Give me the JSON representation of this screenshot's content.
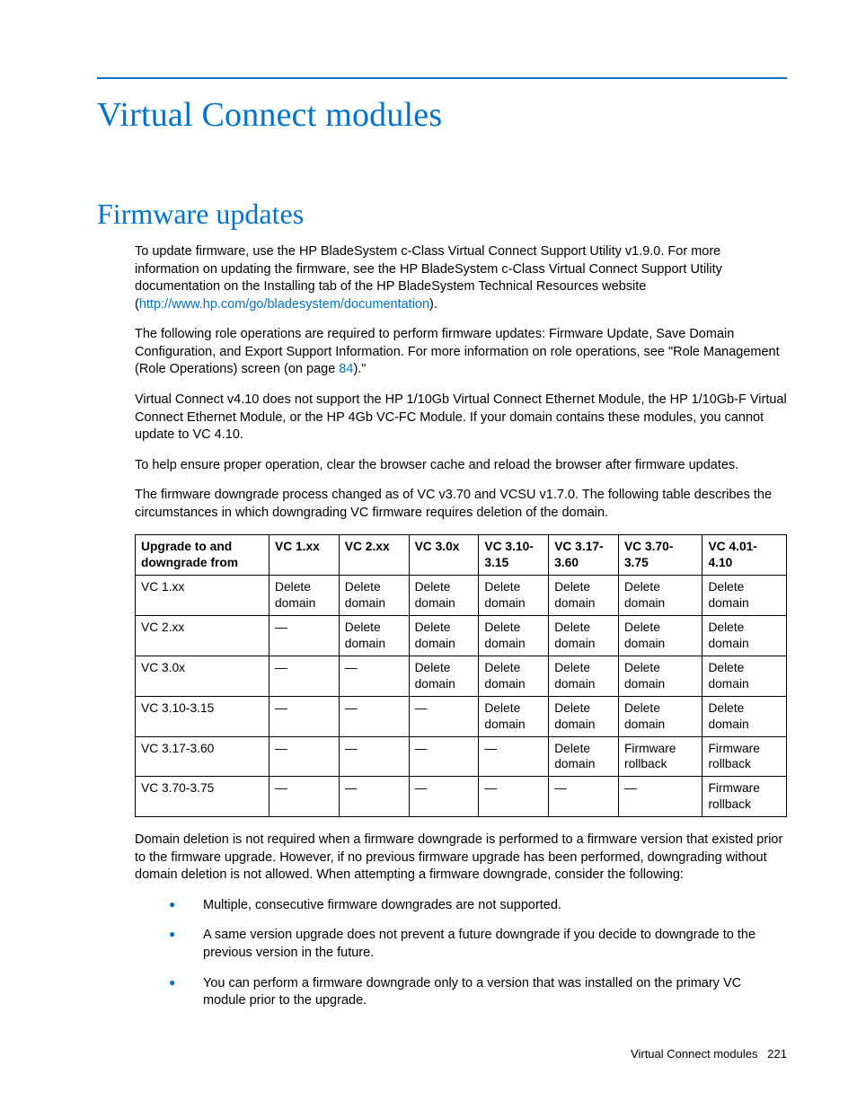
{
  "page_title": "Virtual Connect modules",
  "section_title": "Firmware updates",
  "paragraphs": {
    "p1a": "To update firmware, use the HP BladeSystem c-Class Virtual Connect Support Utility v1.9.0. For more information on updating the firmware, see the HP BladeSystem c-Class Virtual Connect Support Utility documentation on the Installing tab of the HP BladeSystem Technical Resources website (",
    "p1link": "http://www.hp.com/go/bladesystem/documentation",
    "p1b": ").",
    "p2a": "The following role operations are required to perform firmware updates: Firmware Update, Save Domain Configuration, and Export Support Information. For more information on role operations, see \"Role Management (Role Operations) screen (on page ",
    "p2page": "84",
    "p2b": ").\"",
    "p3": "Virtual Connect v4.10 does not support the HP 1/10Gb Virtual Connect Ethernet Module, the HP 1/10Gb-F Virtual Connect Ethernet Module, or the HP 4Gb VC-FC Module. If your domain contains these modules, you cannot update to VC 4.10.",
    "p4": "To help ensure proper operation, clear the browser cache and reload the browser after firmware updates.",
    "p5": "The firmware downgrade process changed as of VC v3.70 and VCSU v1.7.0. The following table describes the circumstances in which downgrading VC firmware requires deletion of the domain.",
    "p6": "Domain deletion is not required when a firmware downgrade is performed to a firmware version that existed prior to the firmware upgrade. However, if no previous firmware upgrade has been performed, downgrading without domain deletion is not allowed. When attempting a firmware downgrade, consider the following:"
  },
  "table": {
    "headers": [
      "Upgrade to and downgrade from",
      "VC 1.xx",
      "VC 2.xx",
      "VC 3.0x",
      "VC 3.10-3.15",
      "VC 3.17-3.60",
      "VC 3.70-3.75",
      "VC 4.01-4.10"
    ],
    "rows": [
      [
        "VC 1.xx",
        "Delete domain",
        "Delete domain",
        "Delete domain",
        "Delete domain",
        "Delete domain",
        "Delete domain",
        "Delete domain"
      ],
      [
        "VC 2.xx",
        "—",
        "Delete domain",
        "Delete domain",
        "Delete domain",
        "Delete domain",
        "Delete domain",
        "Delete domain"
      ],
      [
        "VC 3.0x",
        "—",
        "—",
        "Delete domain",
        "Delete domain",
        "Delete domain",
        "Delete domain",
        "Delete domain"
      ],
      [
        "VC 3.10-3.15",
        "—",
        "—",
        "—",
        "Delete domain",
        "Delete domain",
        "Delete domain",
        "Delete domain"
      ],
      [
        "VC 3.17-3.60",
        "—",
        "—",
        "—",
        "—",
        "Delete domain",
        "Firmware rollback",
        "Firmware rollback"
      ],
      [
        "VC 3.70-3.75",
        "—",
        "—",
        "—",
        "—",
        "—",
        "—",
        "Firmware rollback"
      ]
    ]
  },
  "bullets": [
    "Multiple, consecutive firmware downgrades are not supported.",
    "A same version upgrade does not prevent a future downgrade if you decide to downgrade to the previous version in the future.",
    "You can perform a firmware downgrade only to a version that was installed on the primary VC module prior to the upgrade."
  ],
  "footer": {
    "label": "Virtual Connect modules",
    "page": "221"
  }
}
